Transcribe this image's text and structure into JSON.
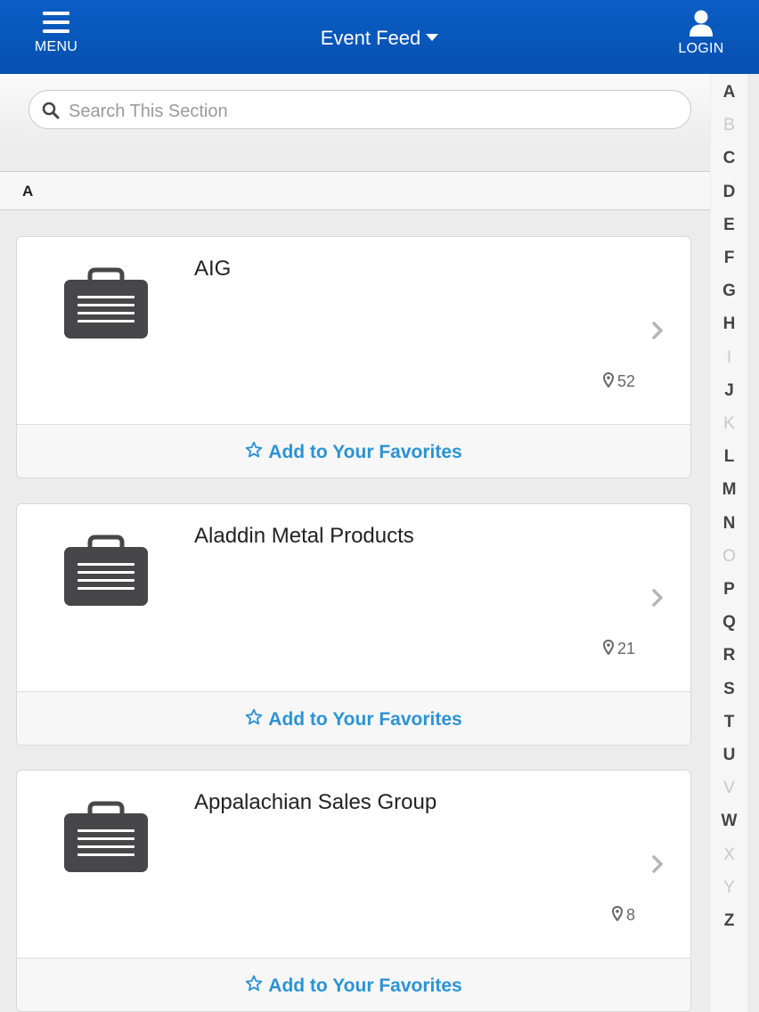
{
  "header": {
    "menu_label": "MENU",
    "title": "Event Feed",
    "login_label": "LOGIN"
  },
  "search": {
    "placeholder": "Search This Section"
  },
  "section": {
    "letter": "A"
  },
  "exhibitors": [
    {
      "name": "AIG",
      "location_count": "52",
      "favorite_label": "Add to Your Favorites"
    },
    {
      "name": "Aladdin Metal Products",
      "location_count": "21",
      "favorite_label": "Add to Your Favorites"
    },
    {
      "name": "Appalachian Sales Group",
      "location_count": "8",
      "favorite_label": "Add to Your Favorites"
    }
  ],
  "alphabet_index": [
    {
      "letter": "A",
      "enabled": true
    },
    {
      "letter": "B",
      "enabled": false
    },
    {
      "letter": "C",
      "enabled": true
    },
    {
      "letter": "D",
      "enabled": true
    },
    {
      "letter": "E",
      "enabled": true
    },
    {
      "letter": "F",
      "enabled": true
    },
    {
      "letter": "G",
      "enabled": true
    },
    {
      "letter": "H",
      "enabled": true
    },
    {
      "letter": "I",
      "enabled": false
    },
    {
      "letter": "J",
      "enabled": true
    },
    {
      "letter": "K",
      "enabled": false
    },
    {
      "letter": "L",
      "enabled": true
    },
    {
      "letter": "M",
      "enabled": true
    },
    {
      "letter": "N",
      "enabled": true
    },
    {
      "letter": "O",
      "enabled": false
    },
    {
      "letter": "P",
      "enabled": true
    },
    {
      "letter": "Q",
      "enabled": true
    },
    {
      "letter": "R",
      "enabled": true
    },
    {
      "letter": "S",
      "enabled": true
    },
    {
      "letter": "T",
      "enabled": true
    },
    {
      "letter": "U",
      "enabled": true
    },
    {
      "letter": "V",
      "enabled": false
    },
    {
      "letter": "W",
      "enabled": true
    },
    {
      "letter": "X",
      "enabled": false
    },
    {
      "letter": "Y",
      "enabled": false
    },
    {
      "letter": "Z",
      "enabled": true
    }
  ],
  "colors": {
    "header_blue": "#0650b0",
    "link_blue": "#2b93d4",
    "icon_dark": "#47474a"
  },
  "icons": {
    "menu": "hamburger-icon",
    "login": "user-icon",
    "search": "magnifier-icon",
    "exhibitor": "briefcase-icon",
    "location": "map-pin-icon",
    "favorite": "star-outline-icon",
    "navigate": "chevron-right-icon"
  }
}
